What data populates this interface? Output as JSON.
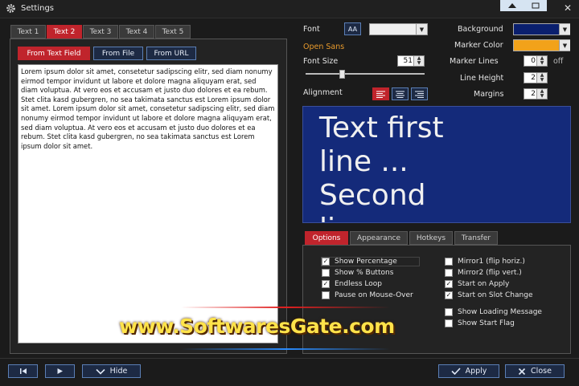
{
  "window": {
    "title": "Settings"
  },
  "text_tabs": [
    "Text 1",
    "Text 2",
    "Text 3",
    "Text 4",
    "Text 5"
  ],
  "source_buttons": {
    "from_text_field": "From Text Field",
    "from_file": "From File",
    "from_url": "From URL"
  },
  "text_content": "Lorem ipsum dolor sit amet, consetetur sadipscing elitr, sed diam nonumy eirmod tempor invidunt ut labore et dolore magna aliquyam erat, sed diam voluptua. At vero eos et accusam et justo duo dolores et ea rebum. Stet clita kasd gubergren, no sea takimata sanctus est Lorem ipsum dolor sit amet. Lorem ipsum dolor sit amet, consetetur sadipscing elitr, sed diam nonumy eirmod tempor invidunt ut labore et dolore magna aliquyam erat, sed diam voluptua. At vero eos et accusam et justo duo dolores et ea rebum. Stet clita kasd gubergren, no sea takimata sanctus est Lorem ipsum dolor sit amet.",
  "font": {
    "label": "Font",
    "font_button": "AA",
    "current_font": "Open Sans",
    "size_label": "Font Size",
    "size_value": "51",
    "alignment_label": "Alignment"
  },
  "colors": {
    "background_label": "Background",
    "background_color": "#0a1f6e",
    "marker_label": "Marker Color",
    "marker_color": "#f2a21a",
    "accent": "#c0242c"
  },
  "settings": {
    "marker_lines_label": "Marker Lines",
    "marker_lines_value": "0",
    "marker_lines_suffix": "off",
    "line_height_label": "Line Height",
    "line_height_value": "2",
    "margins_label": "Margins",
    "margins_value": "2"
  },
  "preview": {
    "line1": "Text first",
    "line2": "line ...",
    "line3": "Second",
    "line4": "li"
  },
  "option_tabs": [
    "Options",
    "Appearance",
    "Hotkeys",
    "Transfer"
  ],
  "options": [
    {
      "label": "Show Percentage",
      "checked": true
    },
    {
      "label": "Show % Buttons",
      "checked": false
    },
    {
      "label": "Endless Loop",
      "checked": true
    },
    {
      "label": "Pause on Mouse-Over",
      "checked": false
    },
    {
      "label": "Mirror1 (flip horiz.)",
      "checked": false
    },
    {
      "label": "Mirror2 (flip vert.)",
      "checked": false
    },
    {
      "label": "Start on Apply",
      "checked": true
    },
    {
      "label": "Start on Slot Change",
      "checked": true
    },
    {
      "label": "Show Loading Message",
      "checked": false
    },
    {
      "label": "Show Start Flag",
      "checked": false
    }
  ],
  "bottom": {
    "first_icon": "skip-start-icon",
    "play_icon": "play-icon",
    "hide_label": "Hide",
    "apply_label": "Apply",
    "close_label": "Close"
  },
  "watermark": "www.SoftwaresGate.com"
}
